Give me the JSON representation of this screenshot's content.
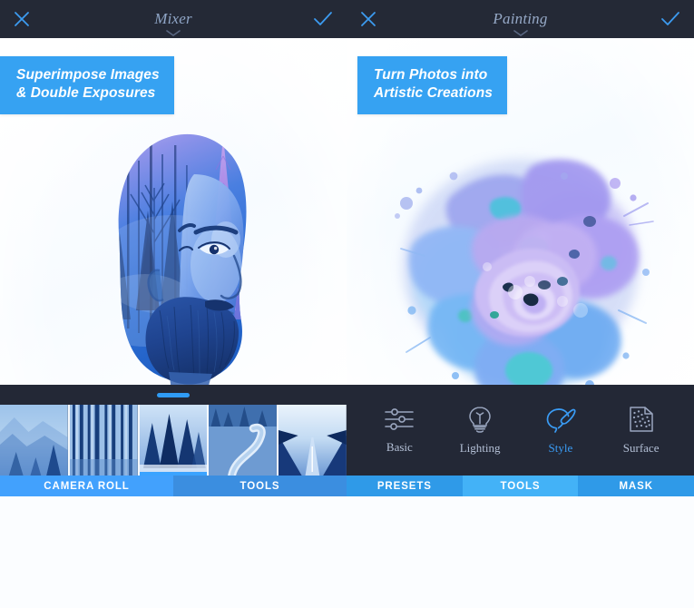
{
  "app": {
    "accent_blue": "#36a2f2",
    "header_bg": "#242936",
    "tab_active": "#42a1fd",
    "tab_inactive": "#3b8ee0"
  },
  "left_screen": {
    "header": {
      "close_icon": "close-icon",
      "title": "Mixer",
      "confirm_icon": "check-icon",
      "chevron_icon": "chevron-down-icon"
    },
    "banner": "Superimpose Images\n& Double Exposures",
    "artwork_alt": "double-exposure-portrait",
    "filmstrip": {
      "handle": "drag-handle",
      "thumbnails": [
        {
          "name": "misty-mountain-forest",
          "selected": false
        },
        {
          "name": "birch-tree-trunks",
          "selected": false
        },
        {
          "name": "pine-forest-snow",
          "selected": true
        },
        {
          "name": "winding-boardwalk",
          "selected": false
        },
        {
          "name": "wet-forest-road",
          "selected": false
        }
      ]
    },
    "tabs": [
      {
        "label": "CAMERA ROLL",
        "active": true
      },
      {
        "label": "TOOLS",
        "active": false
      }
    ]
  },
  "right_screen": {
    "header": {
      "close_icon": "close-icon",
      "title": "Painting",
      "confirm_icon": "check-icon",
      "chevron_icon": "chevron-down-icon"
    },
    "banner": "Turn Photos into\nArtistic Creations",
    "artwork_alt": "watercolor-flower-painting",
    "tools": [
      {
        "label": "Basic",
        "icon": "sliders-icon",
        "active": false
      },
      {
        "label": "Lighting",
        "icon": "lightbulb-icon",
        "active": false
      },
      {
        "label": "Style",
        "icon": "palette-brush-icon",
        "active": true
      },
      {
        "label": "Surface",
        "icon": "texture-page-icon",
        "active": false
      }
    ],
    "tabs": [
      {
        "label": "PRESETS",
        "active": false
      },
      {
        "label": "TOOLS",
        "active": true
      },
      {
        "label": "MASK",
        "active": false
      }
    ]
  }
}
